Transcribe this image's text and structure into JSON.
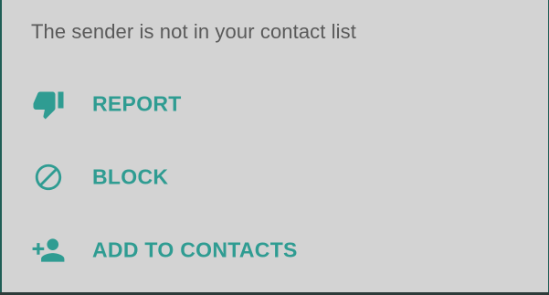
{
  "dialog": {
    "notice_text": "The sender is not in your contact list",
    "accent_color": "#2f9c92",
    "actions": [
      {
        "label": "REPORT",
        "icon": "thumb-down-icon"
      },
      {
        "label": "BLOCK",
        "icon": "block-icon"
      },
      {
        "label": "ADD TO CONTACTS",
        "icon": "person-add-icon"
      }
    ]
  }
}
